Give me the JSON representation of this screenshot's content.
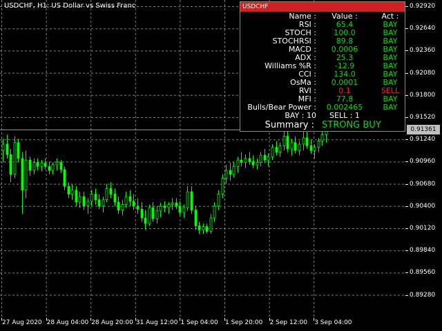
{
  "chart": {
    "symbol_label": "USDCHF, H1:  US Dollar vs Swiss Franc",
    "current_price": "0.91361",
    "price_ticks": [
      "0.92920",
      "0.92640",
      "0.92360",
      "0.92080",
      "0.91800",
      "0.91520",
      "0.91240",
      "0.90960",
      "0.90680",
      "0.90400",
      "0.90120",
      "0.89840",
      "0.89560",
      "0.89280"
    ],
    "time_ticks": [
      "27 Aug 2020",
      "28 Aug 04:00",
      "28 Aug 20:00",
      "31 Aug 12:00",
      "1 Sep 04:00",
      "1 Sep 20:00",
      "2 Sep 12:00",
      "3 Sep 04:00"
    ],
    "colors": {
      "background": "#000000",
      "grid": "#808080",
      "candle": "#00ff00",
      "panel_title": "#cc2222",
      "buy": "#00e000",
      "sell": "#ff2020"
    },
    "price_range": [
      0.8912,
      0.93
    ],
    "candles": [
      [
        0.911,
        0.9125,
        0.9095,
        0.9118
      ],
      [
        0.9118,
        0.913,
        0.91,
        0.9105
      ],
      [
        0.9105,
        0.9112,
        0.907,
        0.908
      ],
      [
        0.908,
        0.9128,
        0.9075,
        0.912
      ],
      [
        0.912,
        0.9125,
        0.9095,
        0.91
      ],
      [
        0.91,
        0.9108,
        0.903,
        0.906
      ],
      [
        0.906,
        0.911,
        0.905,
        0.9098
      ],
      [
        0.9098,
        0.9102,
        0.9078,
        0.9085
      ],
      [
        0.9085,
        0.91,
        0.908,
        0.9095
      ],
      [
        0.9095,
        0.91,
        0.9085,
        0.909
      ],
      [
        0.909,
        0.9098,
        0.9084,
        0.9094
      ],
      [
        0.9094,
        0.91,
        0.9086,
        0.909
      ],
      [
        0.909,
        0.9096,
        0.908,
        0.9085
      ],
      [
        0.9085,
        0.9095,
        0.908,
        0.9092
      ],
      [
        0.9092,
        0.91,
        0.9085,
        0.9095
      ],
      [
        0.9095,
        0.9098,
        0.9082,
        0.9086
      ],
      [
        0.9086,
        0.909,
        0.906,
        0.9065
      ],
      [
        0.9065,
        0.907,
        0.905,
        0.9055
      ],
      [
        0.9055,
        0.9068,
        0.9048,
        0.906
      ],
      [
        0.906,
        0.9065,
        0.904,
        0.9045
      ],
      [
        0.9045,
        0.9058,
        0.9038,
        0.9052
      ],
      [
        0.9052,
        0.9058,
        0.9035,
        0.904
      ],
      [
        0.904,
        0.905,
        0.903,
        0.9046
      ],
      [
        0.9046,
        0.906,
        0.904,
        0.9055
      ],
      [
        0.9055,
        0.9062,
        0.9042,
        0.9048
      ],
      [
        0.9048,
        0.9055,
        0.9036,
        0.904
      ],
      [
        0.904,
        0.9052,
        0.9032,
        0.9048
      ],
      [
        0.9048,
        0.9068,
        0.9045,
        0.9062
      ],
      [
        0.9062,
        0.907,
        0.905,
        0.9055
      ],
      [
        0.9055,
        0.9062,
        0.904,
        0.9045
      ],
      [
        0.9045,
        0.9052,
        0.903,
        0.9035
      ],
      [
        0.9035,
        0.9048,
        0.9028,
        0.9042
      ],
      [
        0.9042,
        0.9058,
        0.9038,
        0.9052
      ],
      [
        0.9052,
        0.906,
        0.904,
        0.9046
      ],
      [
        0.9046,
        0.9055,
        0.9035,
        0.904
      ],
      [
        0.904,
        0.905,
        0.903,
        0.9036
      ],
      [
        0.9036,
        0.9045,
        0.902,
        0.9025
      ],
      [
        0.9025,
        0.9035,
        0.901,
        0.9018
      ],
      [
        0.9018,
        0.9042,
        0.9015,
        0.9038
      ],
      [
        0.9038,
        0.9045,
        0.902,
        0.9024
      ],
      [
        0.9024,
        0.904,
        0.9018,
        0.9034
      ],
      [
        0.9034,
        0.9044,
        0.9026,
        0.904
      ],
      [
        0.904,
        0.9046,
        0.9032,
        0.9038
      ],
      [
        0.9038,
        0.9045,
        0.903,
        0.9042
      ],
      [
        0.9042,
        0.905,
        0.9035,
        0.9044
      ],
      [
        0.9044,
        0.905,
        0.9036,
        0.904
      ],
      [
        0.904,
        0.9046,
        0.9028,
        0.9032
      ],
      [
        0.9032,
        0.9042,
        0.9025,
        0.9038
      ],
      [
        0.9038,
        0.9065,
        0.9034,
        0.9058
      ],
      [
        0.9058,
        0.9065,
        0.903,
        0.9035
      ],
      [
        0.9035,
        0.904,
        0.901,
        0.9015
      ],
      [
        0.9015,
        0.902,
        0.9005,
        0.901
      ],
      [
        0.901,
        0.9018,
        0.9005,
        0.9014
      ],
      [
        0.9014,
        0.9018,
        0.9005,
        0.9008
      ],
      [
        0.9008,
        0.903,
        0.9005,
        0.9025
      ],
      [
        0.9025,
        0.9045,
        0.902,
        0.904
      ],
      [
        0.904,
        0.906,
        0.9035,
        0.9055
      ],
      [
        0.9055,
        0.908,
        0.905,
        0.9075
      ],
      [
        0.9075,
        0.9092,
        0.9068,
        0.9085
      ],
      [
        0.9085,
        0.9095,
        0.9072,
        0.908
      ],
      [
        0.908,
        0.9096,
        0.9076,
        0.909
      ],
      [
        0.909,
        0.9102,
        0.9082,
        0.9098
      ],
      [
        0.9098,
        0.9108,
        0.909,
        0.9095
      ],
      [
        0.9095,
        0.9105,
        0.9088,
        0.91
      ],
      [
        0.91,
        0.9108,
        0.9092,
        0.9096
      ],
      [
        0.9096,
        0.9104,
        0.9088,
        0.9092
      ],
      [
        0.9092,
        0.91,
        0.9086,
        0.9095
      ],
      [
        0.9095,
        0.9108,
        0.909,
        0.9104
      ],
      [
        0.9104,
        0.9112,
        0.9094,
        0.9098
      ],
      [
        0.9098,
        0.9106,
        0.909,
        0.9102
      ],
      [
        0.9102,
        0.9118,
        0.9098,
        0.9114
      ],
      [
        0.9114,
        0.9122,
        0.9104,
        0.9108
      ],
      [
        0.9108,
        0.912,
        0.9102,
        0.9116
      ],
      [
        0.9116,
        0.9135,
        0.911,
        0.9128
      ],
      [
        0.9128,
        0.9138,
        0.9108,
        0.9112
      ],
      [
        0.9112,
        0.9125,
        0.9104,
        0.912
      ],
      [
        0.912,
        0.9128,
        0.9106,
        0.911
      ],
      [
        0.911,
        0.9122,
        0.9104,
        0.9118
      ],
      [
        0.9118,
        0.9134,
        0.911,
        0.9126
      ],
      [
        0.9126,
        0.9136,
        0.9112,
        0.9116
      ],
      [
        0.9116,
        0.9124,
        0.9106,
        0.911
      ],
      [
        0.911,
        0.9118,
        0.91,
        0.9114
      ],
      [
        0.9114,
        0.9126,
        0.9108,
        0.9122
      ],
      [
        0.9122,
        0.9134,
        0.9116,
        0.913
      ],
      [
        0.913,
        0.914,
        0.912,
        0.9136
      ]
    ]
  },
  "panel": {
    "title": "USDCHF",
    "headers": {
      "name": "Name :",
      "value": "Value :",
      "act": "Act :"
    },
    "rows": [
      {
        "name": "RSI :",
        "value": "65.4",
        "act": "BAY",
        "sell": false
      },
      {
        "name": "STOCH :",
        "value": "100.0",
        "act": "BAY",
        "sell": false
      },
      {
        "name": "STOCHRSI :",
        "value": "89.8",
        "act": "BAY",
        "sell": false
      },
      {
        "name": "MACD :",
        "value": "0.0006",
        "act": "BAY",
        "sell": false
      },
      {
        "name": "ADX :",
        "value": "25.3",
        "act": "BAY",
        "sell": false
      },
      {
        "name": "Williams %R :",
        "value": "-12.9",
        "act": "BAY",
        "sell": false
      },
      {
        "name": "CCI :",
        "value": "134.0",
        "act": "BAY",
        "sell": false
      },
      {
        "name": "OsMa :",
        "value": "0.0001",
        "act": "BAY",
        "sell": false
      },
      {
        "name": "RVI :",
        "value": "0.1",
        "act": "SELL",
        "sell": true
      },
      {
        "name": "MFI :",
        "value": "77.8",
        "act": "BAY",
        "sell": false
      },
      {
        "name": "Bulls/Bear Power :",
        "value": "0.002465",
        "act": "BAY",
        "sell": false
      }
    ],
    "counts": {
      "bay": "BAY : 10",
      "sell": "SELL : 1"
    },
    "summary_label": "Summary :",
    "summary_value": "STRONG BUY"
  }
}
